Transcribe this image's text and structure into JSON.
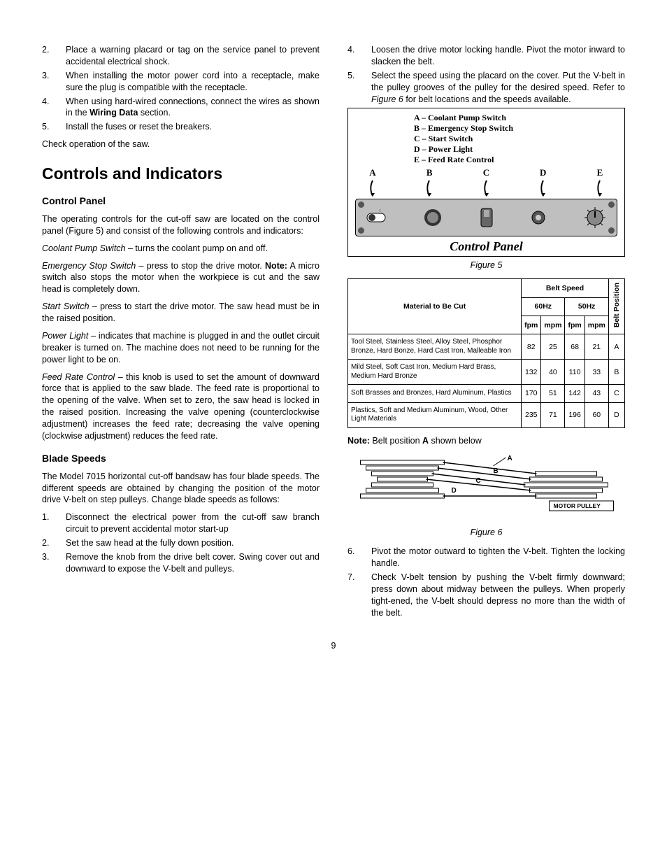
{
  "left": {
    "items_top": [
      {
        "n": "2.",
        "t": "Place a warning placard or tag on the service panel to prevent accidental electrical shock."
      },
      {
        "n": "3.",
        "t": "When installing the motor power cord into a receptacle, make sure the plug is compatible with the receptacle."
      },
      {
        "n": "4.",
        "t_pre": "When using hard-wired connections, connect the wires as shown in the ",
        "t_bold": "Wiring Data",
        "t_post": " section."
      },
      {
        "n": "5.",
        "t": "Install the fuses or reset the breakers."
      }
    ],
    "check": "Check operation of the saw.",
    "h_ci": "Controls and Indicators",
    "h_cp": "Control Panel",
    "cp_intro": "The operating controls for the cut-off saw are located on the control panel (Figure 5) and consist of the following controls and indicators:",
    "cps_i": "Coolant Pump Switch",
    "cps_t": " – turns the coolant pump on and off.",
    "ess_i": "Emergency Stop Switch",
    "ess_t1": " – press to stop the drive motor. ",
    "ess_b": "Note:",
    "ess_t2": " A micro switch also stops the motor when the workpiece is cut and the saw head is completely down.",
    "ss_i": "Start Switch",
    "ss_t": " – press to start the drive motor. The saw head must be in the raised position.",
    "pl_i": "Power Light",
    "pl_t": " – indicates that machine is plugged in and the outlet circuit breaker is turned on. The machine does not need to be running for the power light to be on.",
    "frc_i": "Feed Rate Control",
    "frc_t": " –  this knob is used to set the amount of downward force that is applied to the saw blade. The feed rate is proportional to the opening of the valve. When set to zero, the saw head is locked in the raised position. Increasing the valve opening (counterclockwise adjustment) increases the feed rate; decreasing the valve opening (clockwise adjustment) reduces the feed rate.",
    "h_bs": "Blade Speeds",
    "bs_intro": "The Model 7015 horizontal cut-off bandsaw has four blade speeds. The different speeds are obtained by changing the position of the motor drive V-belt on step pulleys. Change blade speeds as follows:",
    "bs_items": [
      {
        "n": "1.",
        "t": "Disconnect the electrical power from the cut-off saw branch circuit to prevent accidental motor start-up"
      },
      {
        "n": "2.",
        "t": "Set the saw head at the fully down position."
      },
      {
        "n": "3.",
        "t": "Remove the knob from the drive belt cover. Swing cover out and downward to expose the V-belt and pulleys."
      }
    ]
  },
  "right": {
    "items_top": [
      {
        "n": "4.",
        "t": "Loosen the drive motor locking handle. Pivot the motor inward to slacken the belt."
      },
      {
        "n": "5.",
        "t_pre": "Select the speed using the placard on the cover. Put the V-belt in the pulley grooves of the pulley for the desired speed. Refer to ",
        "t_i": "Figure 6",
        "t_post": " for belt locations and the speeds available."
      }
    ],
    "legend": {
      "a": "A – Coolant Pump Switch",
      "b": "B – Emergency Stop Switch",
      "c": "C – Start Switch",
      "d": "D – Power Light",
      "e": "E – Feed Rate Control"
    },
    "letters": [
      "A",
      "B",
      "C",
      "D",
      "E"
    ],
    "panel_label": "Control Panel",
    "fig5": "Figure 5",
    "table": {
      "h_mat": "Material to Be Cut",
      "h_bs": "Belt Speed",
      "h_bp": "Belt Position",
      "h_60": "60Hz",
      "h_50": "50Hz",
      "h_fpm": "fpm",
      "h_mpm": "mpm",
      "rows": [
        {
          "mat": "Tool Steel, Stainless Steel, Alloy Steel, Phosphor Bronze, Hard Bonze, Hard Cast Iron, Malleable Iron",
          "v": [
            "82",
            "25",
            "68",
            "21",
            "A"
          ]
        },
        {
          "mat": "Mild Steel, Soft Cast Iron, Medium Hard Brass, Medium Hard Bronze",
          "v": [
            "132",
            "40",
            "110",
            "33",
            "B"
          ]
        },
        {
          "mat": "Soft Brasses and Bronzes, Hard Aluminum, Plastics",
          "v": [
            "170",
            "51",
            "142",
            "43",
            "C"
          ]
        },
        {
          "mat": "Plastics, Soft and Medium Aluminum, Wood, Other Light Materials",
          "v": [
            "235",
            "71",
            "196",
            "60",
            "D"
          ]
        }
      ]
    },
    "note_pre": "Note:",
    "note_mid": " Belt position ",
    "note_b": "A",
    "note_post": " shown below",
    "fig6_labels": {
      "a": "A",
      "b": "B",
      "c": "C",
      "d": "D",
      "mp": "MOTOR PULLEY"
    },
    "fig6": "Figure 6",
    "items_bot": [
      {
        "n": "6.",
        "t": "Pivot the motor outward to tighten the V-belt. Tighten the locking handle."
      },
      {
        "n": "7.",
        "t": "Check V-belt tension by pushing the V-belt firmly downward; press down about midway between the pulleys. When properly tight-ened, the V-belt should depress no more than the width of the belt."
      }
    ]
  },
  "chart_data": {
    "type": "table",
    "title": "Blade Speed vs Material",
    "columns": [
      "Material",
      "60Hz fpm",
      "60Hz mpm",
      "50Hz fpm",
      "50Hz mpm",
      "Belt Position"
    ],
    "rows": [
      [
        "Tool Steel, Stainless Steel, Alloy Steel, Phosphor Bronze, Hard Bonze, Hard Cast Iron, Malleable Iron",
        82,
        25,
        68,
        21,
        "A"
      ],
      [
        "Mild Steel, Soft Cast Iron, Medium Hard Brass, Medium Hard Bronze",
        132,
        40,
        110,
        33,
        "B"
      ],
      [
        "Soft Brasses and Bronzes, Hard Aluminum, Plastics",
        170,
        51,
        142,
        43,
        "C"
      ],
      [
        "Plastics, Soft and Medium Aluminum, Wood, Other Light Materials",
        235,
        71,
        196,
        60,
        "D"
      ]
    ]
  },
  "page_number": "9"
}
